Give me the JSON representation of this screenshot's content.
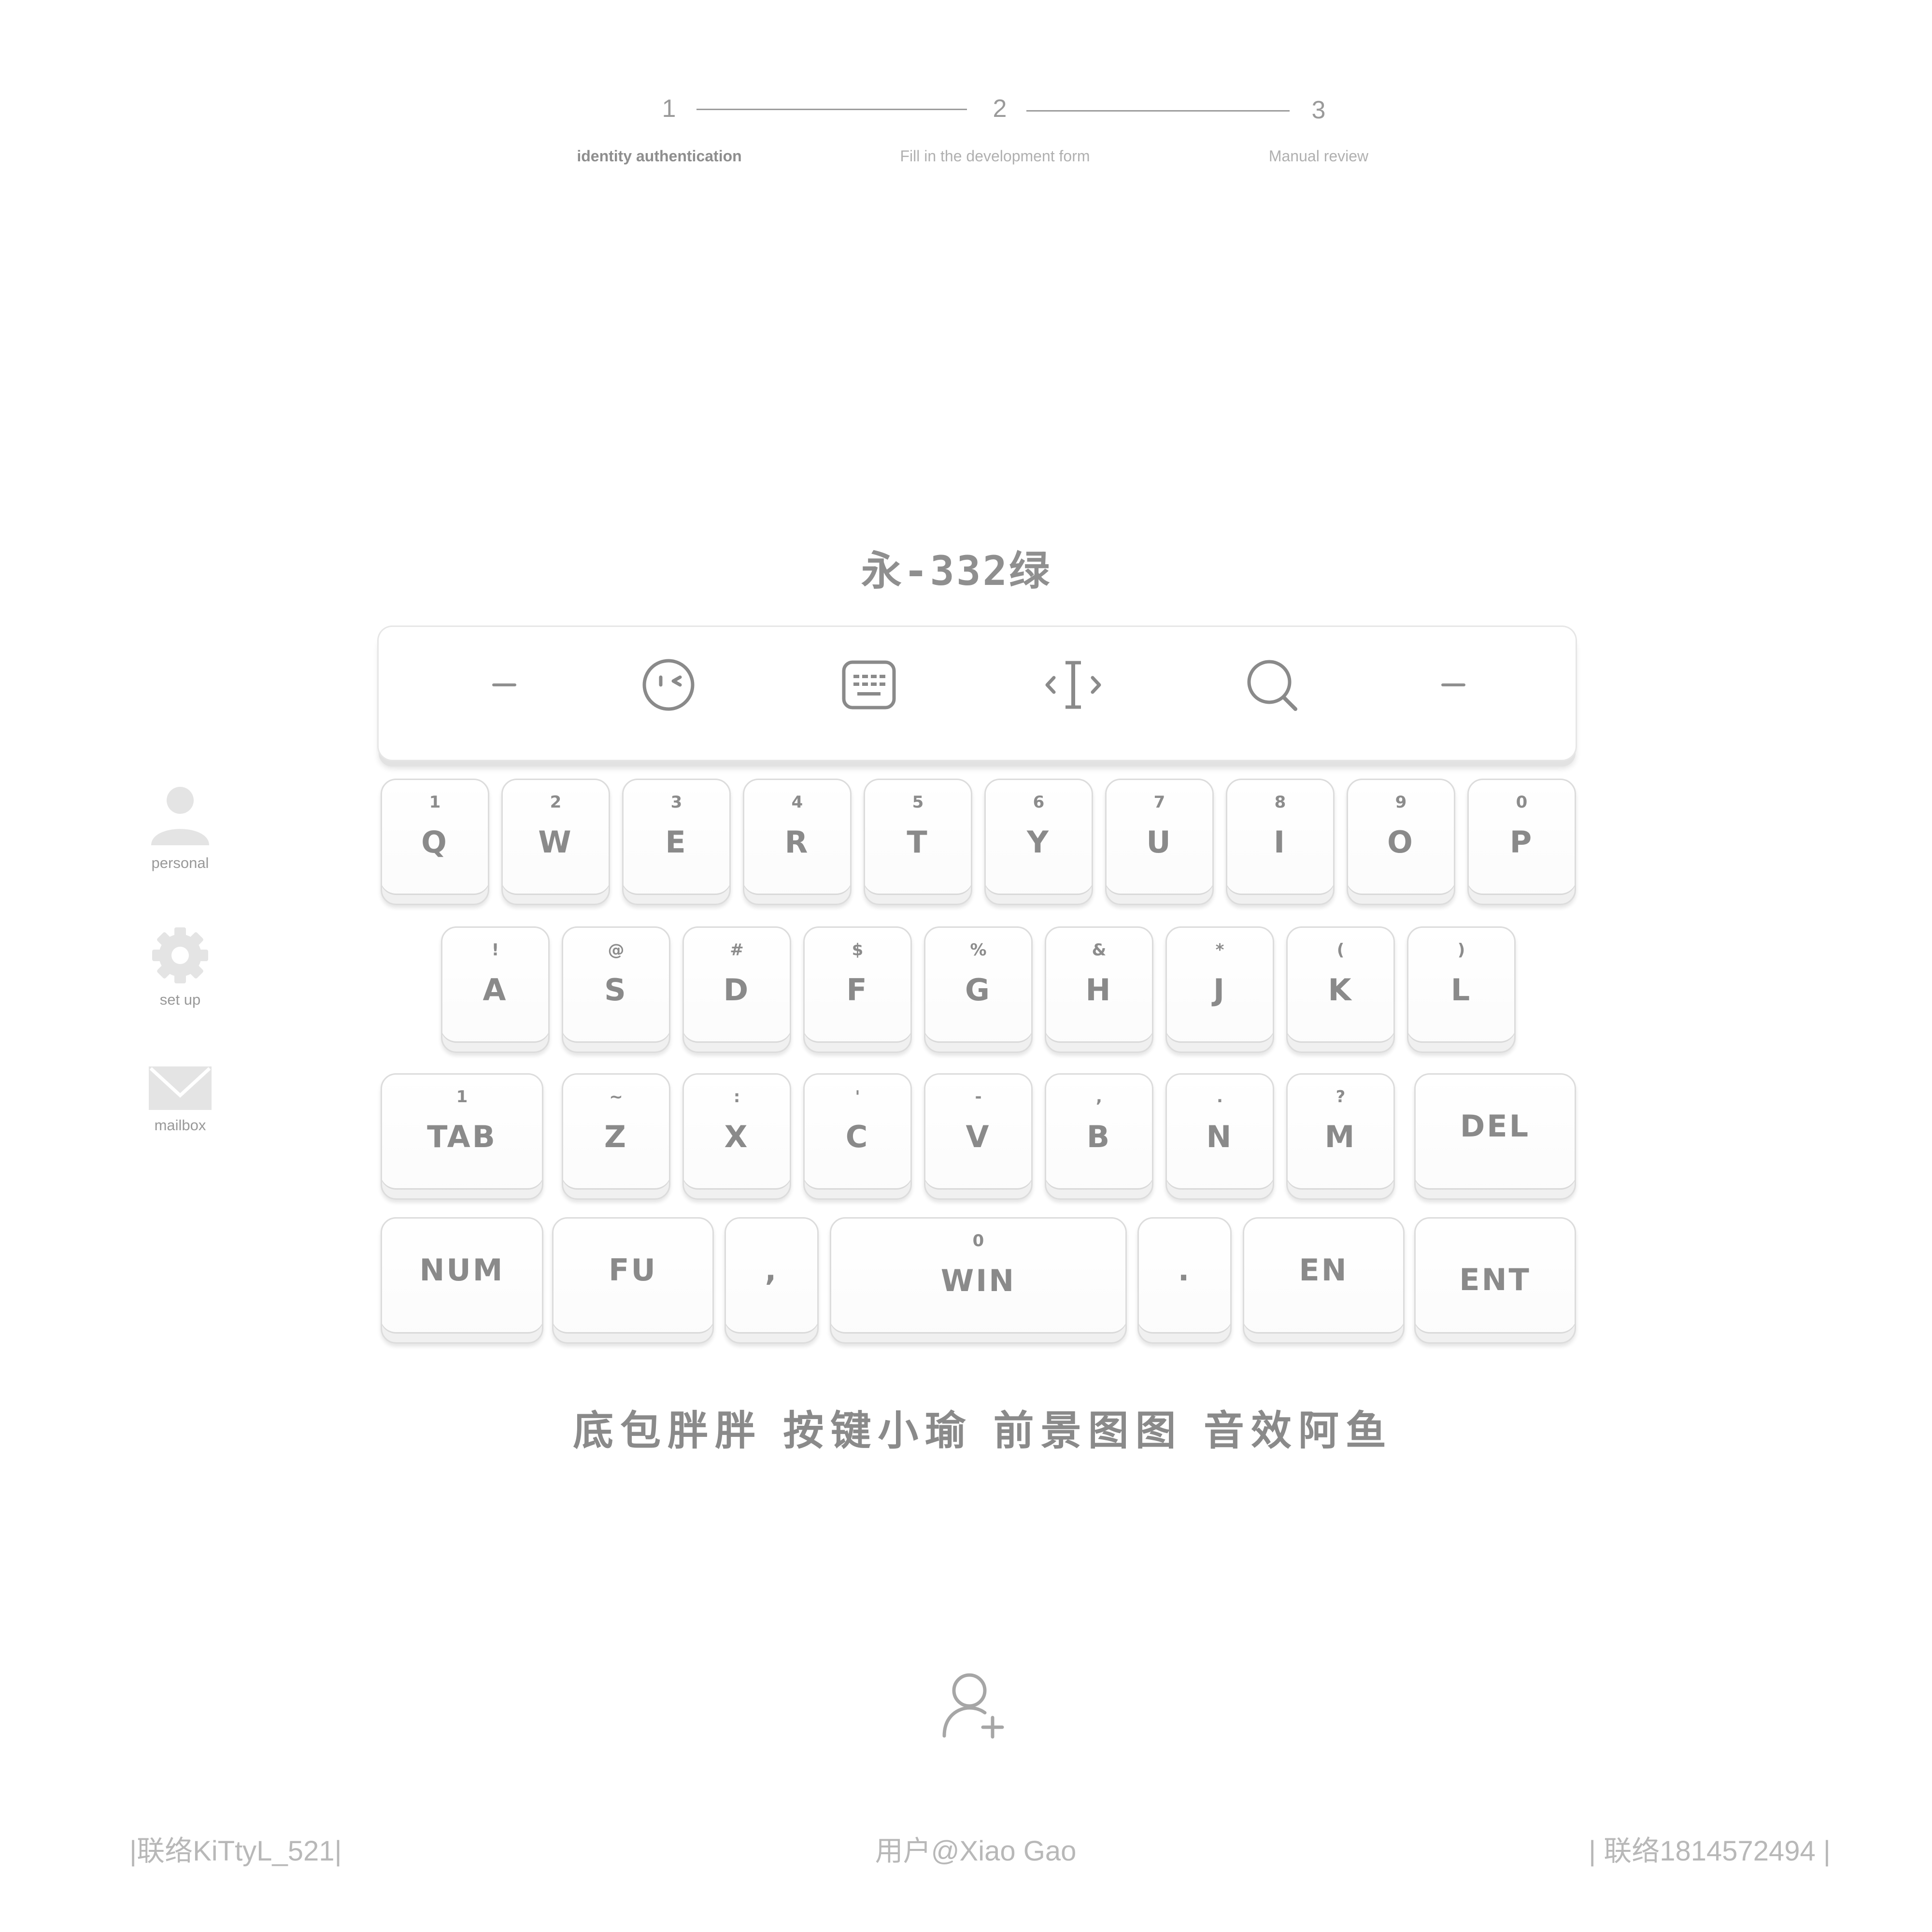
{
  "stepper": {
    "steps": [
      {
        "number": "1",
        "label": "identity authentication"
      },
      {
        "number": "2",
        "label": "Fill in the development form"
      },
      {
        "number": "3",
        "label": "Manual review"
      }
    ]
  },
  "title": "永-332绿",
  "sidebar": {
    "items": [
      {
        "label": "personal",
        "icon": "person-icon"
      },
      {
        "label": "set up",
        "icon": "gear-icon"
      },
      {
        "label": "mailbox",
        "icon": "envelope-icon"
      }
    ]
  },
  "toolbar": {
    "icons": [
      "left-dash-icon",
      "emoji-icon",
      "keyboard-icon",
      "text-cursor-icon",
      "search-icon",
      "right-dash-icon"
    ]
  },
  "keyboard": {
    "row1": [
      {
        "sub": "1",
        "main": "Q"
      },
      {
        "sub": "2",
        "main": "W"
      },
      {
        "sub": "3",
        "main": "E"
      },
      {
        "sub": "4",
        "main": "R"
      },
      {
        "sub": "5",
        "main": "T"
      },
      {
        "sub": "6",
        "main": "Y"
      },
      {
        "sub": "7",
        "main": "U"
      },
      {
        "sub": "8",
        "main": "I"
      },
      {
        "sub": "9",
        "main": "O"
      },
      {
        "sub": "0",
        "main": "P"
      }
    ],
    "row2": [
      {
        "sub": "!",
        "main": "A"
      },
      {
        "sub": "@",
        "main": "S"
      },
      {
        "sub": "#",
        "main": "D"
      },
      {
        "sub": "$",
        "main": "F"
      },
      {
        "sub": "%",
        "main": "G"
      },
      {
        "sub": "&",
        "main": "H"
      },
      {
        "sub": "*",
        "main": "J"
      },
      {
        "sub": "(",
        "main": "K"
      },
      {
        "sub": ")",
        "main": "L"
      }
    ],
    "row3": [
      {
        "sub": "1",
        "main": "TAB"
      },
      {
        "sub": "~",
        "main": "Z"
      },
      {
        "sub": ":",
        "main": "X"
      },
      {
        "sub": "'",
        "main": "C"
      },
      {
        "sub": "-",
        "main": "V"
      },
      {
        "sub": ",",
        "main": "B"
      },
      {
        "sub": ".",
        "main": "N"
      },
      {
        "sub": "?",
        "main": "M"
      },
      {
        "sub": "",
        "main": "DEL"
      }
    ],
    "row4": [
      {
        "sub": "",
        "main": "NUM"
      },
      {
        "sub": "",
        "main": "FU"
      },
      {
        "sub": "",
        "main": ","
      },
      {
        "sub": "0",
        "main": "WIN"
      },
      {
        "sub": "",
        "main": "."
      },
      {
        "sub": "",
        "main": "EN"
      },
      {
        "sub": "",
        "main": "ENT"
      }
    ]
  },
  "credits": "底包胖胖 按键小瑜 前景图图 音效阿鱼",
  "footer": {
    "left": "|联络KiTtyL_521|",
    "center": "用户@Xiao Gao",
    "right": "| 联络1814572494 |"
  },
  "colors": {
    "text_gray": "#8a8a8a",
    "light_gray": "#b8b8b8",
    "key_border": "#dcdcdc",
    "background": "#ffffff"
  }
}
